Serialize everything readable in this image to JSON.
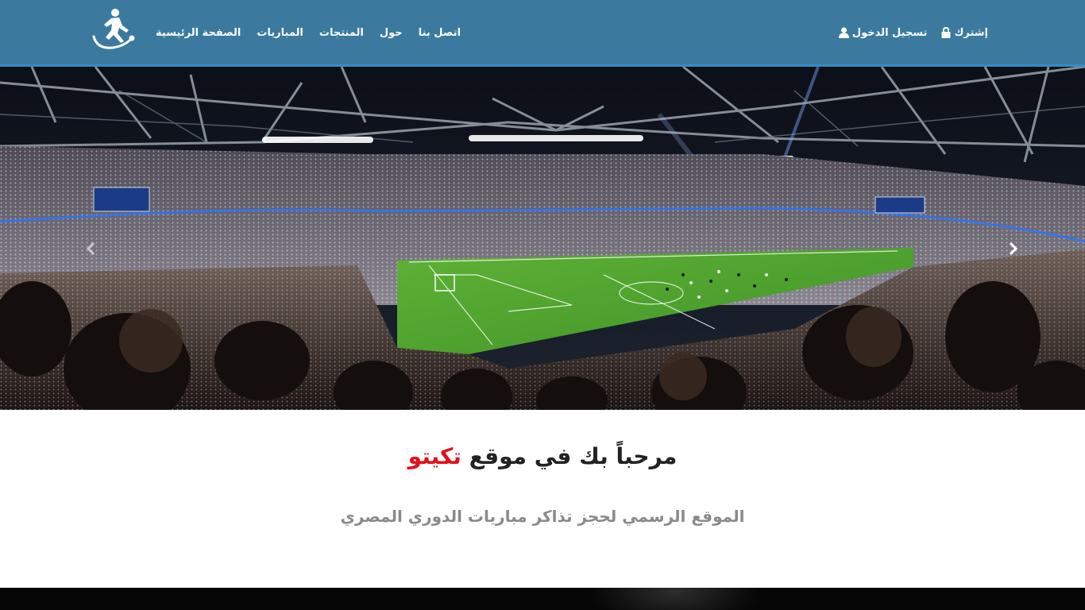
{
  "navbar": {
    "logo_icon": "football-player-logo-icon",
    "links": [
      "الصفحة الرئيسية",
      "المباريات",
      "المنتجات",
      "حول",
      "اتصل بنا"
    ],
    "login_label": "تسجيل الدخول",
    "login_icon": "user-icon",
    "signup_label": "إشترك",
    "signup_icon": "lock-icon",
    "background_color": "#3b7a9e"
  },
  "hero": {
    "image": "football stadium crowd",
    "prev_icon": "chevron-left-icon",
    "next_icon": "chevron-right-icon"
  },
  "welcome": {
    "title_prefix": "مرحباً بك في موقع",
    "title_brand": "تكيتو",
    "brand_color": "#e3101a",
    "subtitle": "الموقع الرسمي لحجز تذاكر مباريات الدوري المصري"
  }
}
